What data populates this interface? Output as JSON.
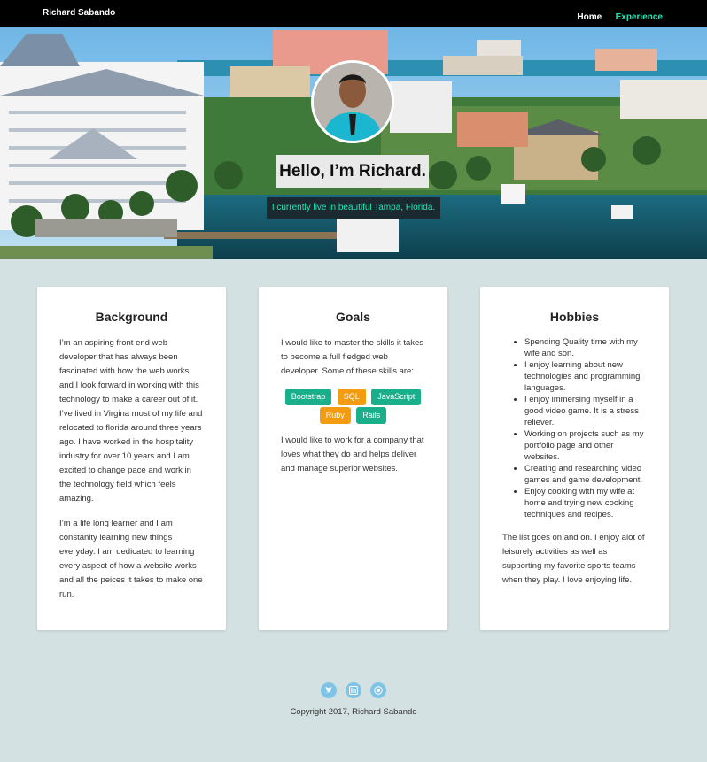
{
  "nav": {
    "brand": "Richard Sabando",
    "links": [
      {
        "label": "Home"
      },
      {
        "label": "Experience"
      }
    ],
    "active_color": "#1de9b6"
  },
  "hero": {
    "title": "Hello, I’m Richard.",
    "subtitle": "I currently live in beautiful Tampa, Florida."
  },
  "cards": {
    "background": {
      "title": "Background",
      "p1": "I’m an aspiring front end web developer that has always been fascinated with how the web works and I look forward in working with this technology to make a career out of it. I’ve lived in Virgina most of my life and relocated to florida around three years ago. I have worked in the hospitality industry for over 10 years and I am excited to change pace and work in the technology field which feels amazing.",
      "p2": "I’m a life long learner and I am constanlty learning new things everyday. I am dedicated to learning every aspect of how a website works and all the peices it takes to make one run."
    },
    "goals": {
      "title": "Goals",
      "p1": "I would like to master the skills it takes to become a full fledged web developer. Some of these skills are:",
      "skills": [
        {
          "label": "Bootstrap",
          "color": "green"
        },
        {
          "label": "SQL",
          "color": "orange"
        },
        {
          "label": "JavaScript",
          "color": "green"
        },
        {
          "label": "Ruby",
          "color": "orange"
        },
        {
          "label": "Rails",
          "color": "green"
        }
      ],
      "p2": "I would like to work for a company that loves what they do and helps deliver and manage superior websites."
    },
    "hobbies": {
      "title": "Hobbies",
      "items": [
        "Spending Quality time with my wife and son.",
        "I enjoy learning about new technologies and programming languages.",
        "I enjoy immersing myself in a good video game. It is a stress reliever.",
        "Working on projects such as my portfolio page and other websites.",
        "Creating and researching video games and game development.",
        "Enjoy cooking with my wife at home and trying new cooking techniques and recipes."
      ],
      "p": "The list goes on and on. I enjoy alot of leisurely activities as well as supporting my favorite sports teams when they play. I love enjoying life."
    }
  },
  "footer": {
    "social_icons": [
      "twitter-icon",
      "linkedin-icon",
      "github-icon"
    ],
    "copyright": "Copyright 2017, Richard Sabando"
  },
  "colors": {
    "page_bg": "#d4e1e2",
    "accent": "#1de9b6",
    "skill_green": "#1aaf8b",
    "skill_orange": "#f39c12",
    "social": "#7fc4e6"
  }
}
